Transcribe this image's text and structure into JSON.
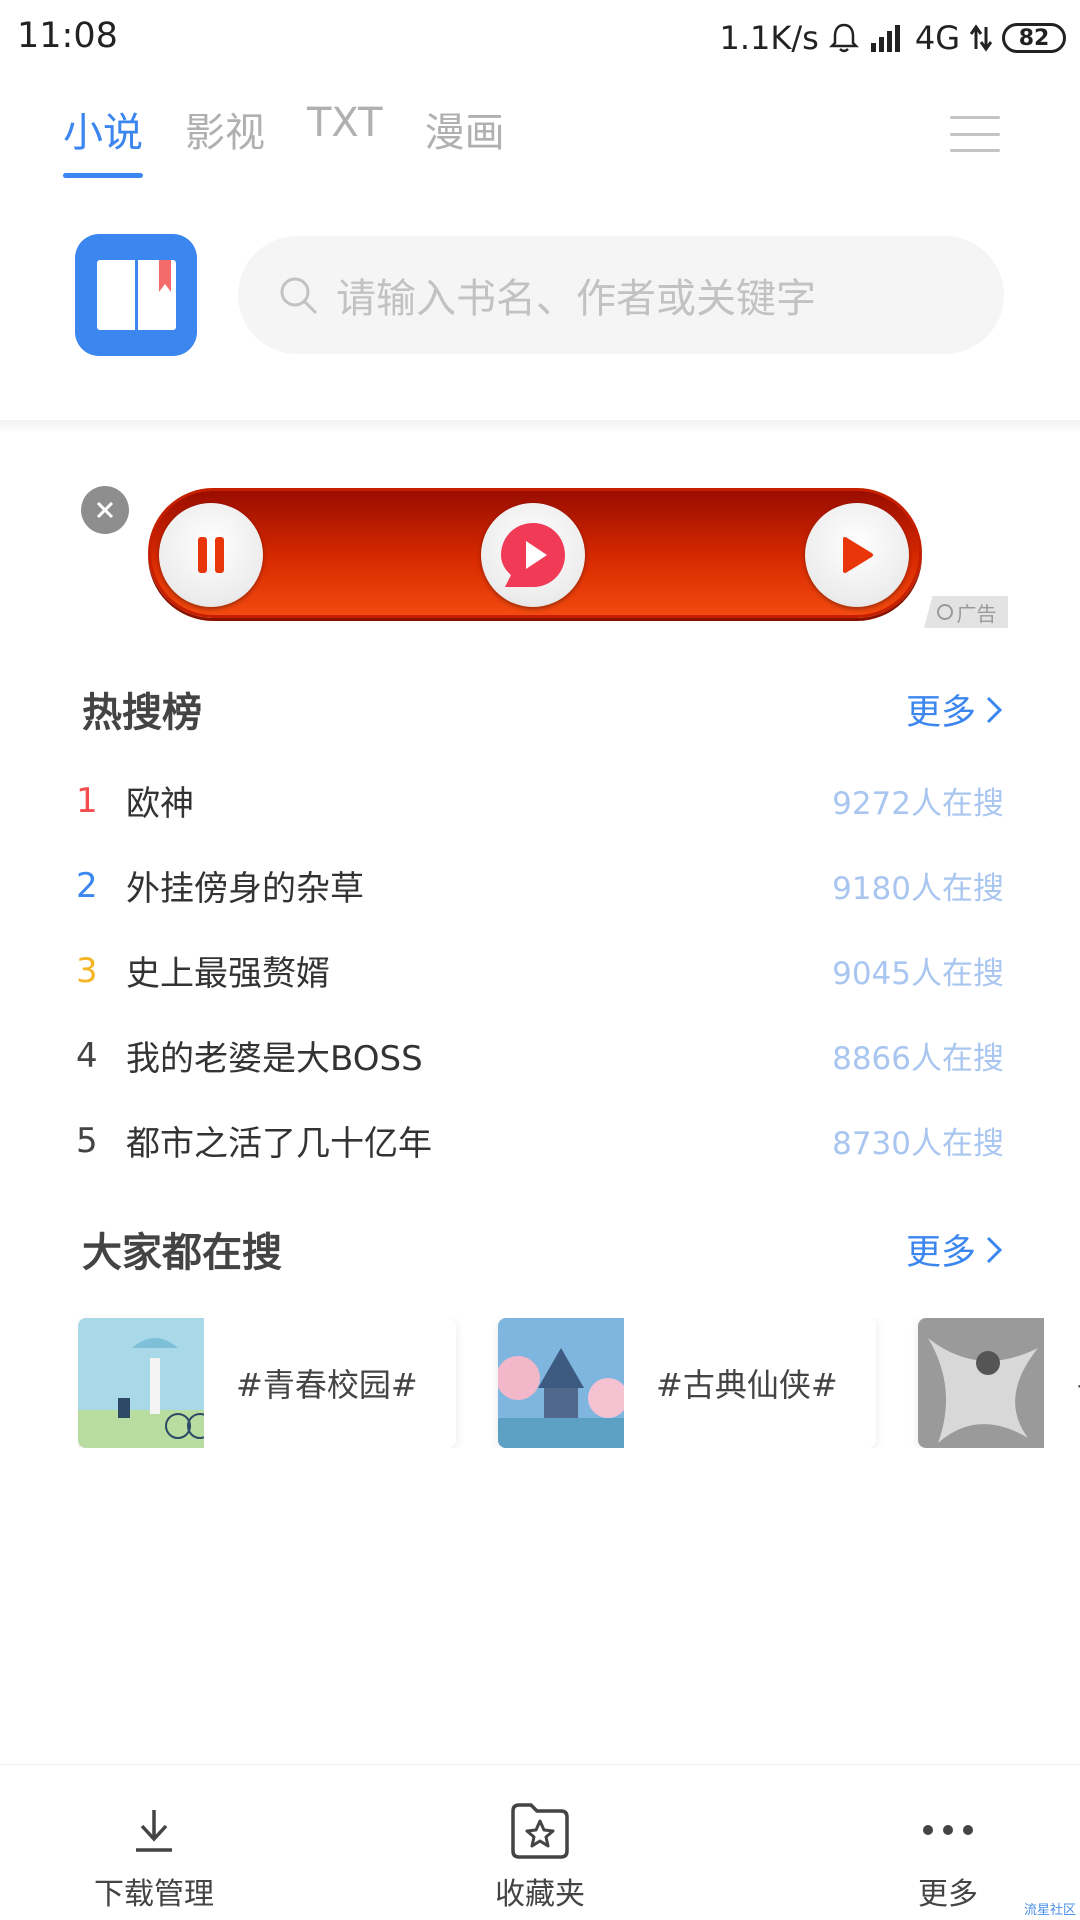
{
  "status_bar": {
    "time": "11:08",
    "net_speed": "1.1K/s",
    "network": "4G",
    "battery": "82"
  },
  "tabs": [
    {
      "label": "小说",
      "active": true
    },
    {
      "label": "影视",
      "active": false
    },
    {
      "label": "TXT",
      "active": false
    },
    {
      "label": "漫画",
      "active": false
    }
  ],
  "search": {
    "placeholder": "请输入书名、作者或关键字"
  },
  "ad": {
    "label": "广告"
  },
  "hot_search": {
    "title": "热搜榜",
    "more": "更多",
    "items": [
      {
        "rank": "1",
        "title": "欧神",
        "count": "9272人在搜",
        "rank_color": "#f24d4d"
      },
      {
        "rank": "2",
        "title": "外挂傍身的杂草",
        "count": "9180人在搜",
        "rank_color": "#3c86f0"
      },
      {
        "rank": "3",
        "title": "史上最强赘婿",
        "count": "9045人在搜",
        "rank_color": "#f7b526"
      },
      {
        "rank": "4",
        "title": "我的老婆是大BOSS",
        "count": "8866人在搜",
        "rank_color": "#444444"
      },
      {
        "rank": "5",
        "title": "都市之活了几十亿年",
        "count": "8730人在搜",
        "rank_color": "#444444"
      }
    ]
  },
  "everyone_search": {
    "title": "大家都在搜",
    "more": "更多",
    "cards": [
      {
        "label": "#青春校园#"
      },
      {
        "label": "#古典仙侠#"
      },
      {
        "label": "#"
      }
    ]
  },
  "bottom_nav": {
    "download": "下载管理",
    "favorites": "收藏夹",
    "more": "更多"
  },
  "watermark": "流星社区",
  "colors": {
    "accent": "#3c86f0",
    "count": "#a9c6f1"
  }
}
